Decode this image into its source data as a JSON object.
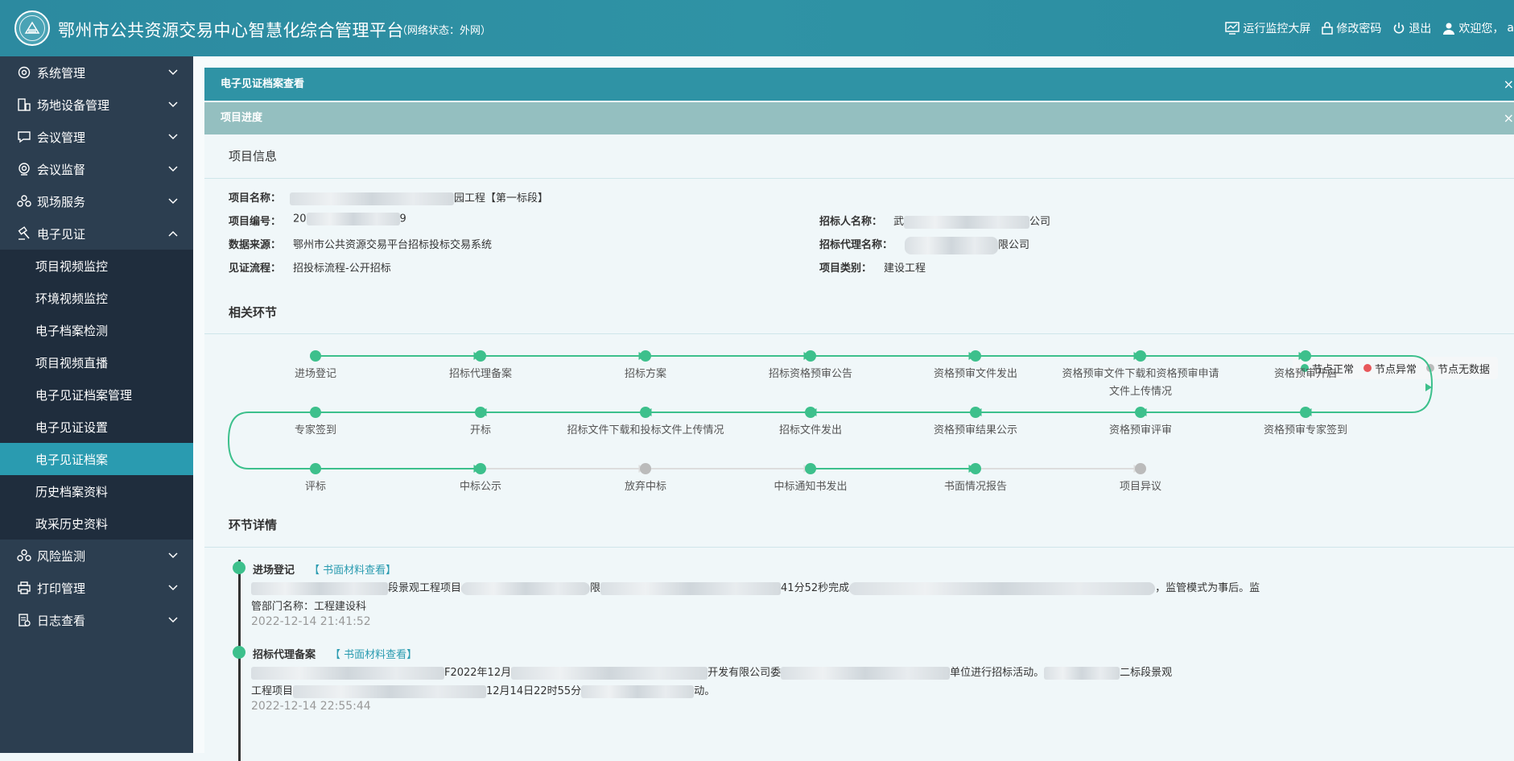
{
  "header": {
    "title": "鄂州市公共资源交易中心智慧化综合管理平台",
    "network_status": "（网络状态：外网）",
    "actions": {
      "monitor_screen": "运行监控大屏",
      "change_password": "修改密码",
      "logout": "退出",
      "welcome": "欢迎您，",
      "welcome_tail": "a"
    }
  },
  "sidebar": {
    "items": [
      {
        "label": "系统管理",
        "icon": "gear-icon"
      },
      {
        "label": "场地设备管理",
        "icon": "device-icon"
      },
      {
        "label": "会议管理",
        "icon": "chat-icon"
      },
      {
        "label": "会议监督",
        "icon": "camera-icon"
      },
      {
        "label": "现场服务",
        "icon": "service-icon"
      },
      {
        "label": "电子见证",
        "icon": "hammer-icon",
        "expanded": true
      },
      {
        "label": "风险监测",
        "icon": "risk-icon"
      },
      {
        "label": "打印管理",
        "icon": "printer-icon"
      },
      {
        "label": "日志查看",
        "icon": "log-icon"
      }
    ],
    "submenu": [
      {
        "label": "项目视频监控"
      },
      {
        "label": "环境视频监控"
      },
      {
        "label": "电子档案检测"
      },
      {
        "label": "项目视频直播"
      },
      {
        "label": "电子见证档案管理"
      },
      {
        "label": "电子见证设置"
      },
      {
        "label": "电子见证档案",
        "active": true
      },
      {
        "label": "历史档案资料"
      },
      {
        "label": "政采历史资料"
      }
    ]
  },
  "main": {
    "panel1_title": "电子见证档案查看",
    "panel2_title": "项目进度",
    "close_symbol": "×",
    "project_info_title": "项目信息",
    "info": {
      "name_label": "项目名称：",
      "name_value": "园工程【第一标段】",
      "code_label": "项目编号：",
      "code_prefix": "20",
      "code_suffix": "9",
      "source_label": "数据来源：",
      "source_value": "鄂州市公共资源交易平台招标投标交易系统",
      "flow_label": "见证流程：",
      "flow_value": "招投标流程-公开招标",
      "tenderer_label": "招标人名称：",
      "tenderer_prefix": "武",
      "tenderer_suffix": "公司",
      "agent_label": "招标代理名称：",
      "agent_suffix": "限公司",
      "category_label": "项目类别：",
      "category_value": "建设工程"
    },
    "related_title": "相关环节",
    "legend": [
      {
        "label": "节点正常",
        "color": "#3dc08c"
      },
      {
        "label": "节点异常",
        "color": "#e8575a"
      },
      {
        "label": "节点无数据",
        "color": "#bbbbbb"
      }
    ],
    "flow_rows": [
      [
        {
          "label": "进场登记",
          "status": "normal"
        },
        {
          "label": "招标代理备案",
          "status": "normal"
        },
        {
          "label": "招标方案",
          "status": "normal"
        },
        {
          "label": "招标资格预审公告",
          "status": "normal"
        },
        {
          "label": "资格预审文件发出",
          "status": "normal"
        },
        {
          "label": "资格预审文件下载和资格预审申请文件上传情况",
          "status": "normal"
        },
        {
          "label": "资格预审开启",
          "status": "normal"
        }
      ],
      [
        {
          "label": "专家签到",
          "status": "normal"
        },
        {
          "label": "开标",
          "status": "normal"
        },
        {
          "label": "招标文件下载和投标文件上传情况",
          "status": "normal"
        },
        {
          "label": "招标文件发出",
          "status": "normal"
        },
        {
          "label": "资格预审结果公示",
          "status": "normal"
        },
        {
          "label": "资格预审评审",
          "status": "normal"
        },
        {
          "label": "资格预审专家签到",
          "status": "normal"
        }
      ],
      [
        {
          "label": "评标",
          "status": "normal"
        },
        {
          "label": "中标公示",
          "status": "normal"
        },
        {
          "label": "放弃中标",
          "status": "nodata"
        },
        {
          "label": "中标通知书发出",
          "status": "normal"
        },
        {
          "label": "书面情况报告",
          "status": "normal"
        },
        {
          "label": "项目异议",
          "status": "nodata"
        }
      ]
    ],
    "detail_title": "环节详情",
    "timeline": [
      {
        "title": "进场登记",
        "link": "【 书面材料查看】",
        "line1_a": "段景观工程项目",
        "line1_b": "限",
        "line1_c": "41分52秒完成",
        "line1_d": "，监管模式为事后。监",
        "line2": "管部门名称：工程建设科",
        "time": "2022-12-14 21:41:52"
      },
      {
        "title": "招标代理备案",
        "link": "【 书面材料查看】",
        "line1_a": "F2022年12月",
        "line1_b": "开发有限公司委",
        "line1_c": "单位进行招标活动。",
        "line1_d": "二标段景观",
        "line2_a": "工程项目",
        "line2_b": "12月14日22时55分",
        "line2_c": "动。",
        "time": "2022-12-14 22:55:44"
      }
    ]
  },
  "colors": {
    "header": "#2f93a5",
    "sidebar": "#2c3e50",
    "submenu": "#1f2d3d",
    "active": "#2a9bb0",
    "node_normal": "#3dc08c",
    "node_nodata": "#bbbbbb"
  }
}
